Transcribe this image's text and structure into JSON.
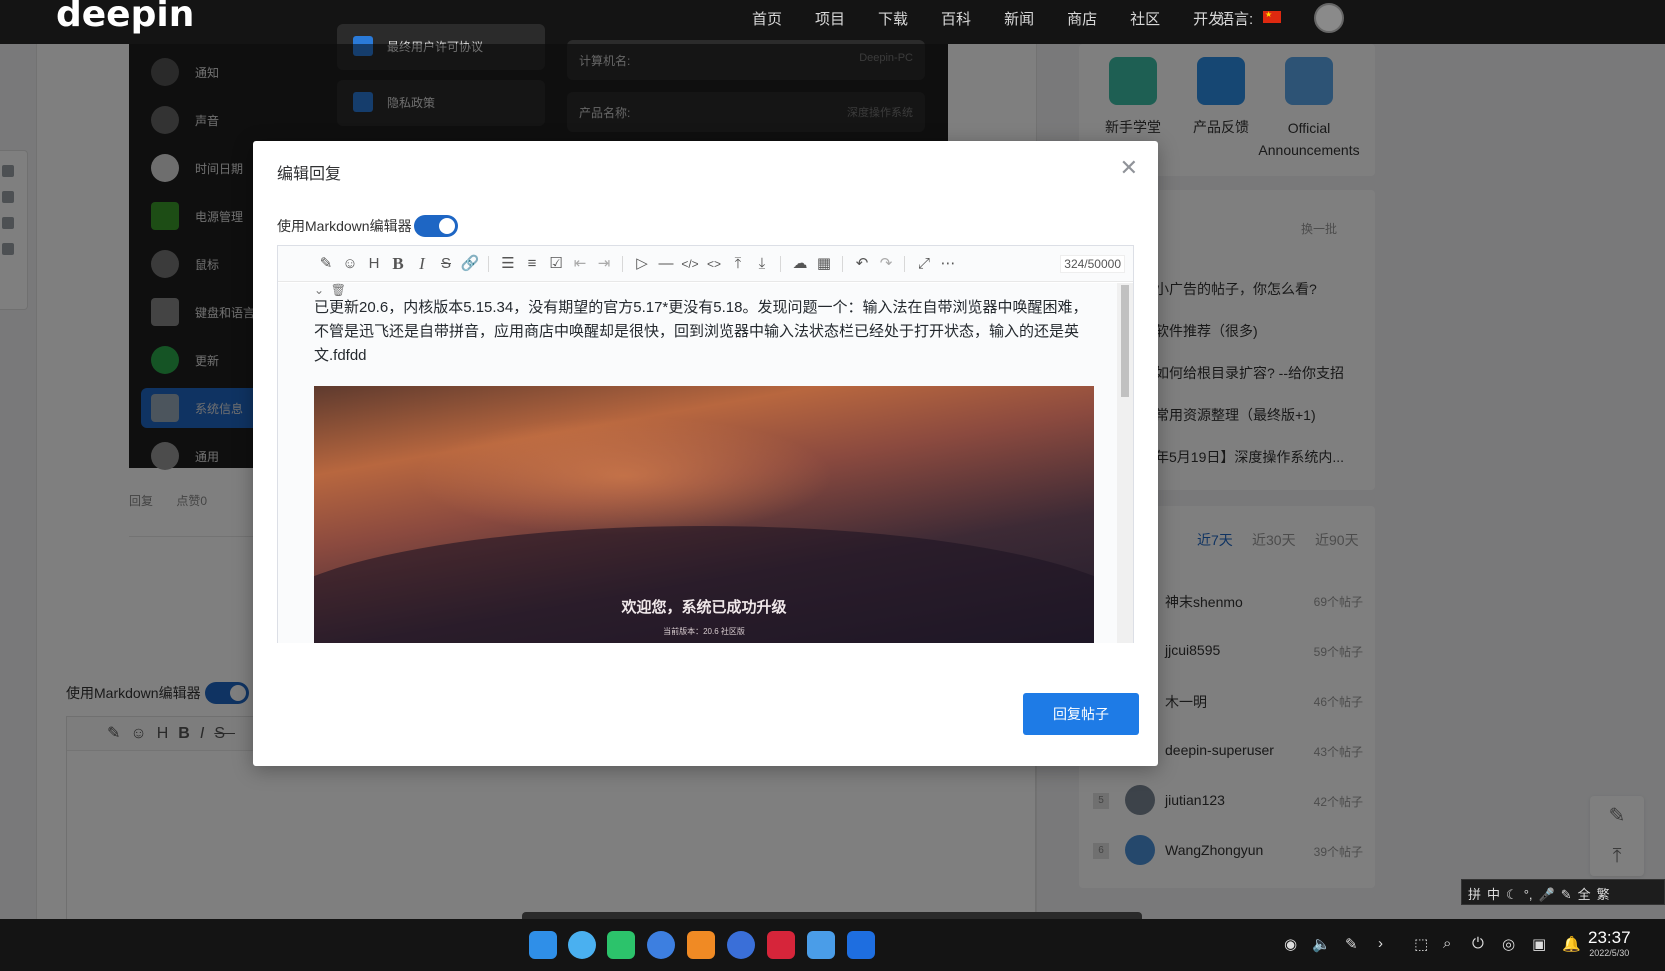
{
  "topnav": {
    "logo": "deepin",
    "items": [
      "首页",
      "项目",
      "下载",
      "百科",
      "新闻",
      "商店",
      "社区",
      "开发"
    ],
    "language_label": "语言:"
  },
  "settings_screenshot": {
    "sidebar": [
      "通知",
      "声音",
      "时间日期",
      "电源管理",
      "鼠标",
      "键盘和语言",
      "更新",
      "系统信息",
      "通用"
    ],
    "active_index": 7,
    "middle": [
      "最终用户许可协议",
      "隐私政策"
    ],
    "info": [
      {
        "label": "计算机名:",
        "value": "Deepin-PC"
      },
      {
        "label": "产品名称:",
        "value": "深度操作系统"
      }
    ]
  },
  "post_actions": {
    "reply": "回复",
    "like": "点赞0"
  },
  "bottom_editor": {
    "md_label": "使用Markdown编辑器"
  },
  "right": {
    "apps": [
      {
        "label": "新手学堂",
        "color": "#3dbfa6"
      },
      {
        "label": "产品反馈",
        "color": "#2c8fe6"
      },
      {
        "label": "Official Announcements",
        "color": "#5aa6ea"
      }
    ],
    "refresh": "换一批",
    "topics": [
      "小广告的帖子，你怎么看?",
      "软件推荐（很多)",
      "如何给根目录扩容? --给你支招",
      "常用资源整理（最终版+1)",
      "年5月19日】深度操作系统内..."
    ],
    "ranges": [
      "近7天",
      "近30天",
      "近90天"
    ],
    "users": [
      {
        "rank": "",
        "name": "神末shenmo",
        "count": "69个帖子"
      },
      {
        "rank": "",
        "name": "jjcui8595",
        "count": "59个帖子"
      },
      {
        "rank": "",
        "name": "木一明",
        "count": "46个帖子"
      },
      {
        "rank": "",
        "name": "deepin-superuser",
        "count": "43个帖子"
      },
      {
        "rank": "5",
        "name": "jiutian123",
        "count": "42个帖子"
      },
      {
        "rank": "6",
        "name": "WangZhongyun",
        "count": "39个帖子"
      }
    ]
  },
  "modal": {
    "title": "编辑回复",
    "md_label": "使用Markdown编辑器",
    "md_enabled": true,
    "counter": "324/50000",
    "content": "已更新20.6，内核版本5.15.34，没有期望的官方5.17*更没有5.18。发现问题一个：输入法在自带浏览器中唤醒困难，不管是迅飞还是自带拼音，应用商店中唤醒却是很快，回到浏览器中输入法状态栏已经处于打开状态，输入的还是英文.fdfdd",
    "image": {
      "welcome": "欢迎您，系统已成功升级",
      "version": "当前版本：20.6 社区版"
    },
    "submit": "回复帖子"
  },
  "ime": [
    "拼",
    "中",
    "☾",
    "°,",
    "🎤",
    "✎",
    "全",
    "繁"
  ],
  "clock": {
    "time": "23:37",
    "date": "2022/5/30"
  }
}
